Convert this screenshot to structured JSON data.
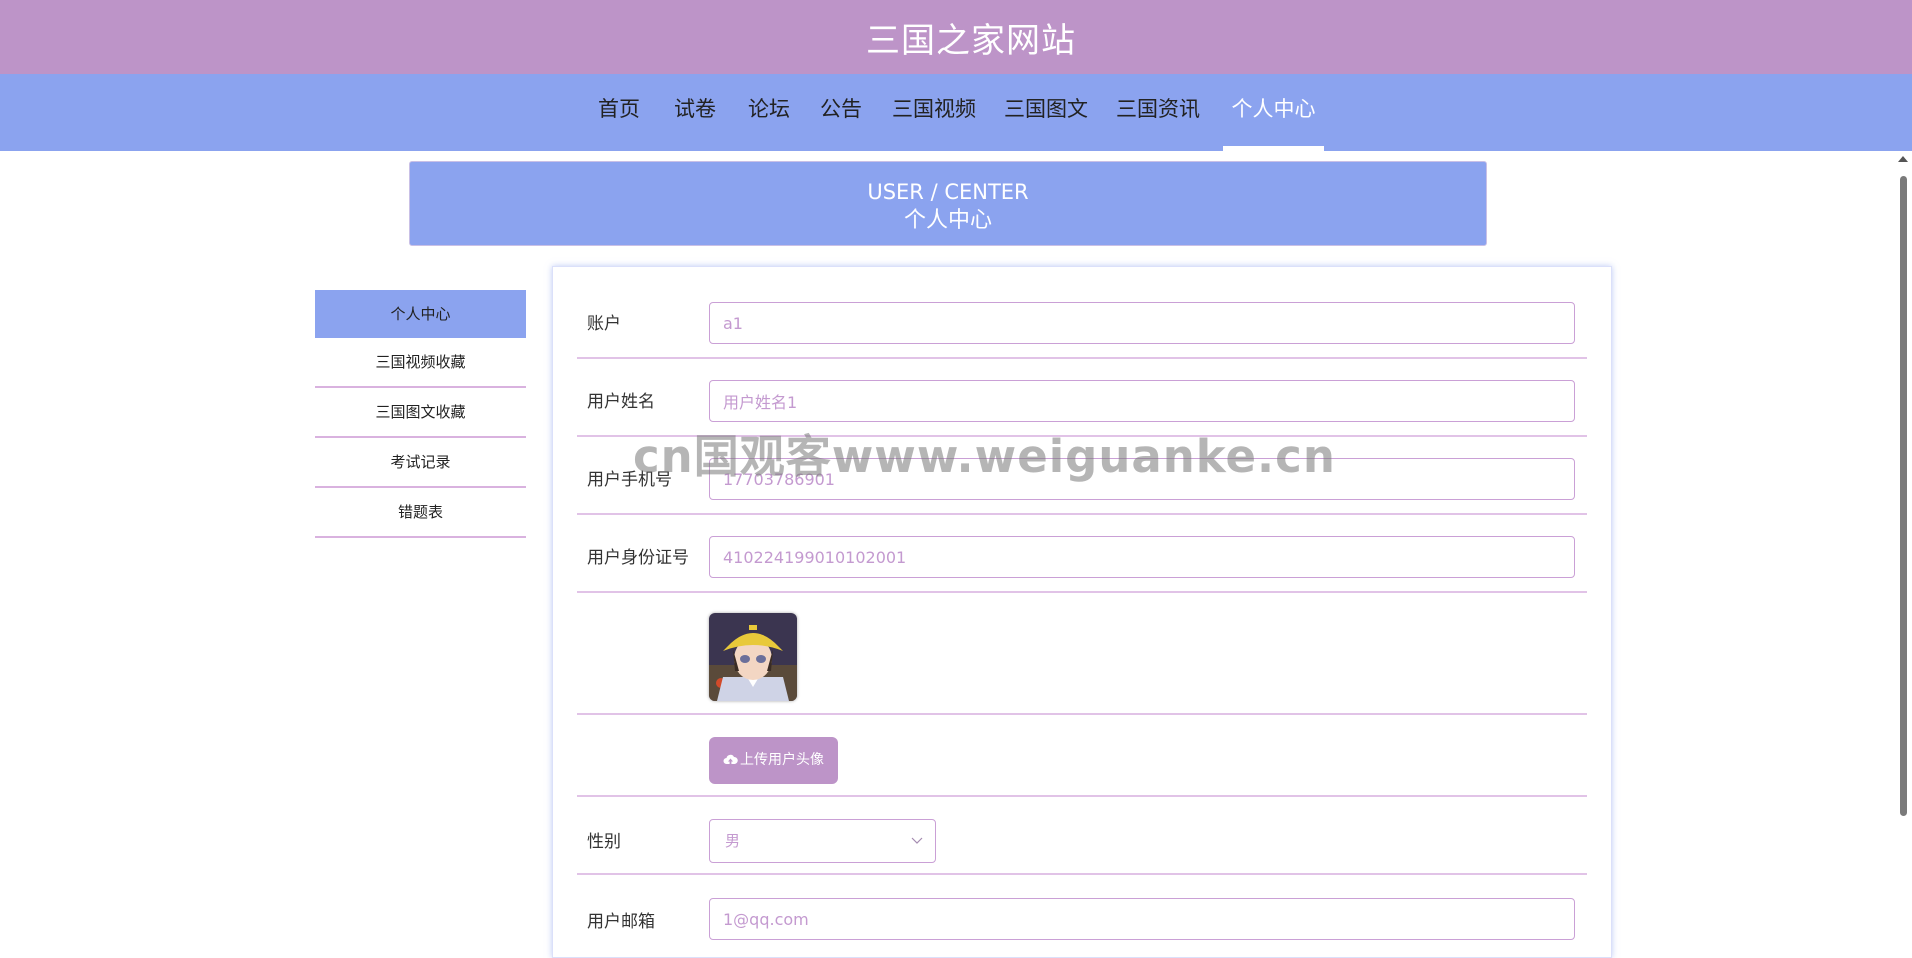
{
  "header": {
    "title": "三国之家网站"
  },
  "nav": {
    "items": [
      {
        "label": "首页"
      },
      {
        "label": "试卷"
      },
      {
        "label": "论坛"
      },
      {
        "label": "公告"
      },
      {
        "label": "三国视频"
      },
      {
        "label": "三国图文"
      },
      {
        "label": "三国资讯"
      },
      {
        "label": "个人中心"
      }
    ],
    "active": "个人中心"
  },
  "banner": {
    "en": "USER / CENTER",
    "cn": "个人中心"
  },
  "sidebar": {
    "items": [
      {
        "label": "个人中心"
      },
      {
        "label": "三国视频收藏"
      },
      {
        "label": "三国图文收藏"
      },
      {
        "label": "考试记录"
      },
      {
        "label": "错题表"
      }
    ],
    "active": "个人中心"
  },
  "form": {
    "account": {
      "label": "账户",
      "value": "a1"
    },
    "name": {
      "label": "用户姓名",
      "value": "用户姓名1"
    },
    "phone": {
      "label": "用户手机号",
      "value": "17703786901"
    },
    "id_card": {
      "label": "用户身份证号",
      "value": "410224199010102001"
    },
    "upload_label": "上传用户头像",
    "gender": {
      "label": "性别",
      "value": "男"
    },
    "email": {
      "label": "用户邮箱",
      "value": "1@qq.com"
    }
  },
  "watermark": "cn国观客www.weiguanke.cn",
  "colors": {
    "header": "#bd94c8",
    "nav": "#8ba3ef",
    "accent": "#8ba3ef",
    "button": "#bd94c8"
  },
  "icons": {
    "upload": "cloud-upload-icon",
    "select": "chevron-down-icon"
  }
}
